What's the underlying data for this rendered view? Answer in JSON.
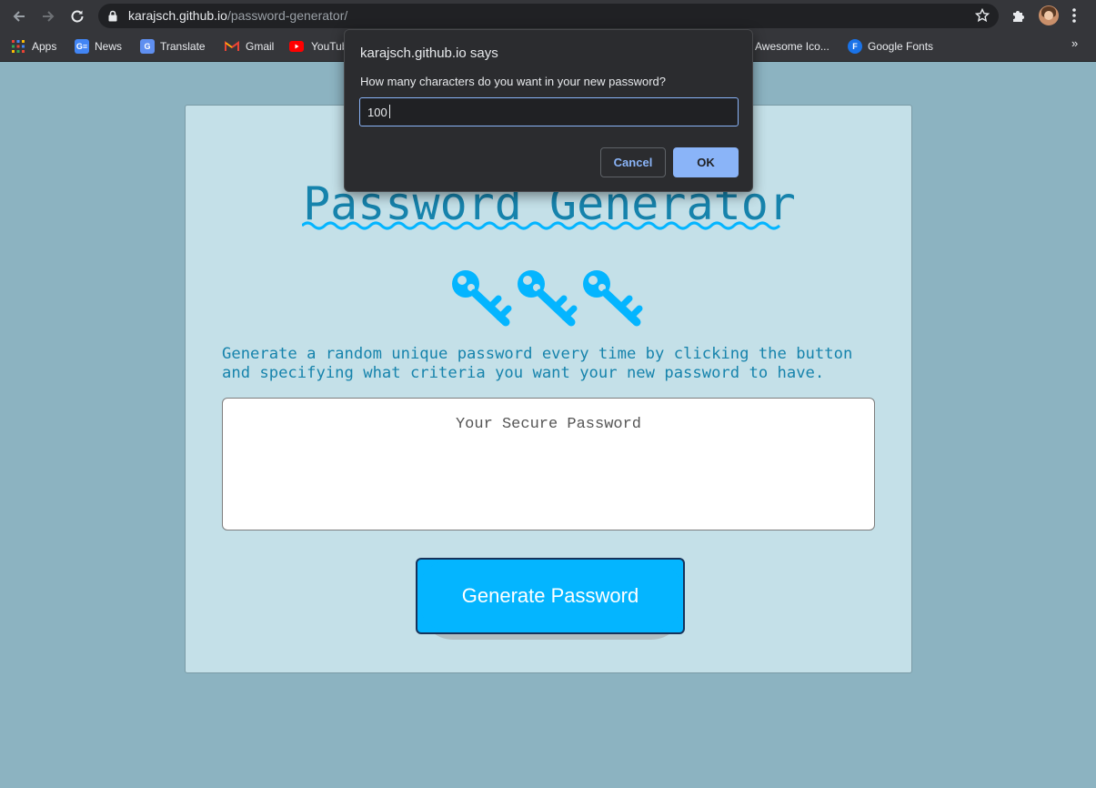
{
  "browser": {
    "url_host": "karajsch.github.io",
    "url_path": "/password-generator/",
    "bookmarks": [
      {
        "label": "Apps",
        "icon": "apps-grid-icon"
      },
      {
        "label": "News",
        "icon": "google-news-icon"
      },
      {
        "label": "Translate",
        "icon": "google-translate-icon"
      },
      {
        "label": "Gmail",
        "icon": "gmail-icon"
      },
      {
        "label": "YouTub",
        "icon": "youtube-icon"
      },
      {
        "label": "Awesome Ico...",
        "icon": "font-awesome-icon"
      },
      {
        "label": "Google Fonts",
        "icon": "google-fonts-icon"
      }
    ],
    "bookmarks_overflow": "»"
  },
  "page": {
    "title": "Password Generator",
    "description": "Generate a random unique password every time by clicking the button and specifying what criteria you want your new password to have.",
    "password_placeholder": "Your Secure Password",
    "generate_button": "Generate Password",
    "icon_count": 3
  },
  "dialog": {
    "title": "karajsch.github.io says",
    "message": "How many characters do you want in your new password?",
    "input_value": "100",
    "cancel_label": "Cancel",
    "ok_label": "OK"
  },
  "colors": {
    "page_background": "#8cb3c1",
    "card_background": "#c4e0e8",
    "title_color": "#1683ac",
    "accent_blue": "#04b5ff",
    "dialog_background": "#2b2c2f",
    "dialog_accent": "#8ab4f8"
  }
}
